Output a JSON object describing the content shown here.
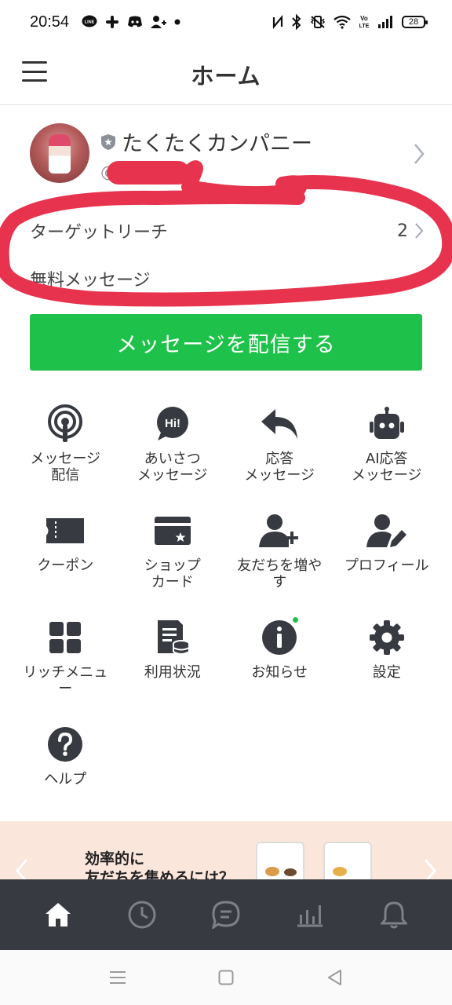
{
  "status_bar": {
    "time": "20:54",
    "battery": "28",
    "left_icons": [
      "line-icon",
      "slack-icon",
      "discord-icon",
      "add-friend-icon",
      "dot-icon"
    ],
    "right_icons": [
      "nfc-icon",
      "bluetooth-icon",
      "vibrate-icon",
      "wifi-icon",
      "volte-icon",
      "signal-icon"
    ]
  },
  "header": {
    "title": "ホーム",
    "menu_icon": "hamburger-icon"
  },
  "account": {
    "name": "たくたくカンパニー",
    "id_prefix": "@",
    "badge_icon": "shield-icon"
  },
  "stats": {
    "target_reach_label": "ターゲットリーチ",
    "target_reach_value": "2",
    "free_message_label": "無料メッセージ"
  },
  "primary_action": {
    "label": "メッセージを配信する"
  },
  "menu": [
    {
      "label": "メッセージ\n配信",
      "icon": "broadcast-icon"
    },
    {
      "label": "あいさつ\nメッセージ",
      "icon": "greeting-icon"
    },
    {
      "label": "応答\nメッセージ",
      "icon": "reply-icon"
    },
    {
      "label": "AI応答\nメッセージ",
      "icon": "robot-icon"
    },
    {
      "label": "クーポン",
      "icon": "coupon-icon"
    },
    {
      "label": "ショップ\nカード",
      "icon": "shop-card-icon"
    },
    {
      "label": "友だちを増や\nす",
      "icon": "add-friends-icon"
    },
    {
      "label": "プロフィール",
      "icon": "profile-edit-icon"
    },
    {
      "label": "リッチメニュ\nー",
      "icon": "rich-menu-icon"
    },
    {
      "label": "利用状況",
      "icon": "usage-icon"
    },
    {
      "label": "お知らせ",
      "icon": "info-icon"
    },
    {
      "label": "設定",
      "icon": "settings-icon"
    },
    {
      "label": "ヘルプ",
      "icon": "help-icon"
    }
  ],
  "banner": {
    "text": "効率的に\n友だちを集めるには？"
  },
  "tab_bar": [
    "home-icon",
    "clock-icon",
    "chat-icon",
    "stats-icon",
    "bell-icon"
  ],
  "colors": {
    "accent_green": "#1ec24a",
    "tab_bar_bg": "#373a40",
    "scribble_red": "#e8334f",
    "banner_bg": "#fbe6dc"
  }
}
